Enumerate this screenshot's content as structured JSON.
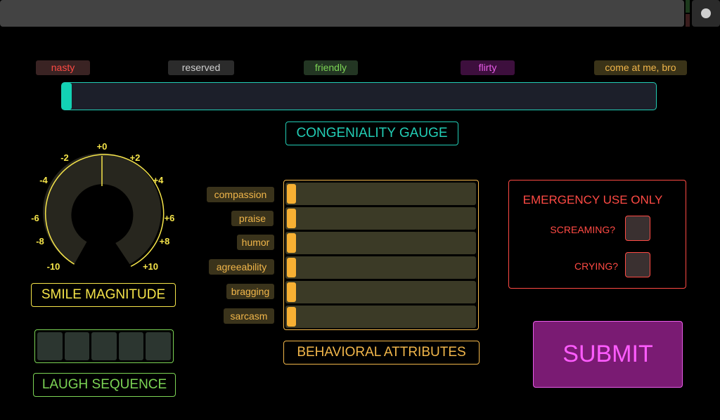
{
  "colors": {
    "teal": "#22cdb5",
    "yellow": "#f6e54a",
    "green": "#7cd455",
    "orange": "#f1b64a",
    "red": "#ff4a44",
    "magenta": "#e85ce8"
  },
  "mood_tags": {
    "nasty": "nasty",
    "reserved": "reserved",
    "friendly": "friendly",
    "flirty": "flirty",
    "bro": "come at me, bro"
  },
  "congeniality": {
    "label": "CONGENIALITY GAUGE",
    "value": 0
  },
  "smile": {
    "label": "SMILE MAGNITUDE",
    "value": 0,
    "ticks": [
      "-10",
      "-8",
      "-6",
      "-4",
      "-2",
      "+0",
      "+2",
      "+4",
      "+6",
      "+8",
      "+10"
    ]
  },
  "laugh": {
    "label": "LAUGH SEQUENCE",
    "cells": 5
  },
  "behavior": {
    "title": "BEHAVIORAL ATTRIBUTES",
    "attributes": [
      {
        "label": "compassion",
        "value": 0
      },
      {
        "label": "praise",
        "value": 0
      },
      {
        "label": "humor",
        "value": 0
      },
      {
        "label": "agreeability",
        "value": 0
      },
      {
        "label": "bragging",
        "value": 0
      },
      {
        "label": "sarcasm",
        "value": 0
      }
    ]
  },
  "emergency": {
    "title": "EMERGENCY USE ONLY",
    "screaming_label": "SCREAMING?",
    "crying_label": "CRYING?"
  },
  "submit": {
    "label": "SUBMIT"
  }
}
